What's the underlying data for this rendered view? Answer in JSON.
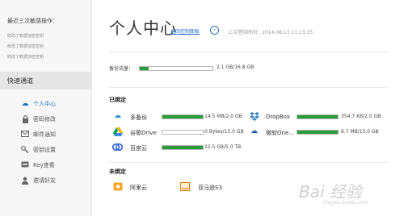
{
  "sidebar": {
    "recent_title": "最近三次敏感操作：",
    "recent_items": [
      "修改了数据加密密钥",
      "修改了数据加密密钥",
      "修改了数据加密密钥"
    ],
    "quick_title": "快速通道",
    "nav": [
      {
        "label": "个人中心",
        "icon": "cloud-icon",
        "active": true
      },
      {
        "label": "密码修改",
        "icon": "lock-icon"
      },
      {
        "label": "邮件通知",
        "icon": "mail-icon"
      },
      {
        "label": "密钥设置",
        "icon": "key-icon"
      },
      {
        "label": "Key查看",
        "icon": "key-card-icon"
      },
      {
        "label": "邀请好友",
        "icon": "user-icon"
      }
    ]
  },
  "header": {
    "title": "个人中心",
    "back_link": "返回控制面板",
    "last_login": "上次登陆时间：2014.08.13 11:13:35"
  },
  "quota": {
    "label": "备份流量：",
    "value": "2.1 GB/16.8 GB",
    "fraction": 0.125
  },
  "bound": {
    "title": "已绑定",
    "services": [
      {
        "name": "多备份",
        "value": "14.5 MB/2.0 GB",
        "fraction": 0.99,
        "icon": "cloud-sync-icon",
        "color": "#2a8fd6"
      },
      {
        "name": "谷歌Drive",
        "value": "0 Bytes/15.0 GB",
        "fraction": 0.0,
        "icon": "google-drive-icon",
        "color": "#f4b400"
      },
      {
        "name": "百度云",
        "value": "22.5 GB/5.0 TB",
        "fraction": 0.99,
        "icon": "baidu-cloud-icon",
        "color": "#2d62d8"
      },
      {
        "name": "DropBox",
        "value": "354.7 KB/2.0 GB",
        "fraction": 0.99,
        "icon": "dropbox-icon",
        "color": "#3d86c8"
      },
      {
        "name": "微软One...",
        "value": "6.7 MB/15.0 GB",
        "fraction": 0.99,
        "icon": "onedrive-icon",
        "color": "#1c5fb0"
      }
    ]
  },
  "unbound": {
    "title": "未绑定",
    "services": [
      {
        "name": "阿里云",
        "icon": "aliyun-icon",
        "color": "#f5a623"
      },
      {
        "name": "亚马逊S3",
        "icon": "amazon-s3-icon",
        "color": "#e07b00"
      }
    ]
  },
  "watermark": {
    "main": "Bai 经验",
    "sub": "jingyan.baidu.com"
  }
}
